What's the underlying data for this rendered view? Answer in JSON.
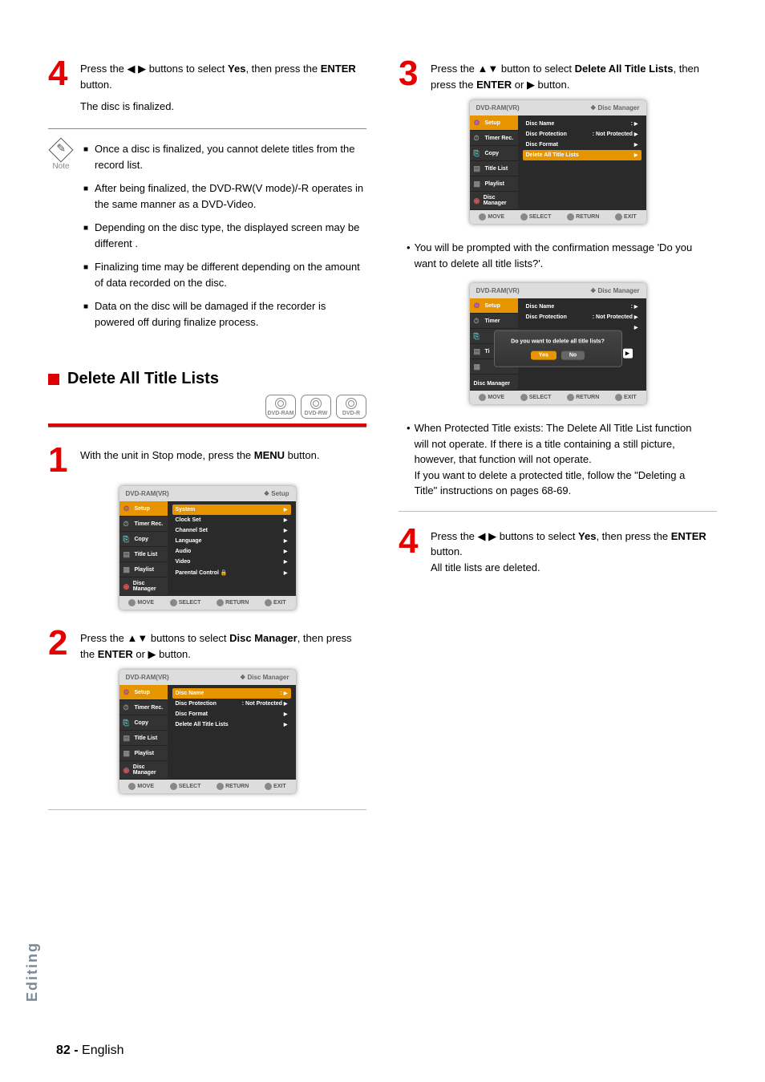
{
  "left": {
    "step4": {
      "text": "Press the ◀ ▶ buttons to select Yes, then press the ENTER button.",
      "sub": "The disc is finalized."
    },
    "note": {
      "label": "Note",
      "items": [
        "Once a disc is finalized, you cannot delete titles from the record list.",
        "After being finalized, the DVD-RW(V mode)/-R operates in the same manner as a DVD-Video.",
        "Depending on the disc type, the displayed screen may be different .",
        "Finalizing time may be different depending on the amount of data recorded on the disc.",
        "Data on the disc will be damaged if the recorder is powered off during finalize process."
      ]
    },
    "section": {
      "title": "Delete All Title Lists"
    },
    "discs": [
      "DVD-RAM",
      "DVD-RW",
      "DVD-R"
    ],
    "step1": {
      "text": "With the unit in Stop mode, press the MENU button."
    },
    "osd1": {
      "headerLeft": "DVD-RAM(VR)",
      "headerRight": "❖  Setup",
      "side": [
        "Setup",
        "Timer Rec.",
        "Copy",
        "Title List",
        "Playlist",
        "Disc Manager"
      ],
      "main": [
        "System",
        "Clock Set",
        "Channel Set",
        "Language",
        "Audio",
        "Video",
        "Parental Control"
      ],
      "foot": [
        "MOVE",
        "SELECT",
        "RETURN",
        "EXIT"
      ]
    },
    "step2": {
      "text": "Press the ▲▼ buttons to select Disc Manager, then press the ENTER or ▶ button."
    },
    "osd2": {
      "headerLeft": "DVD-RAM(VR)",
      "headerRight": "❖ Disc Manager",
      "side": [
        "Setup",
        "Timer Rec.",
        "Copy",
        "Title List",
        "Playlist",
        "Disc Manager"
      ],
      "main": [
        {
          "l": "Disc Name",
          "r": ":"
        },
        {
          "l": "Disc Protection",
          "r": ": Not Protected"
        },
        {
          "l": "Disc Format",
          "r": ""
        },
        {
          "l": "Delete All Title Lists",
          "r": ""
        }
      ],
      "foot": [
        "MOVE",
        "SELECT",
        "RETURN",
        "EXIT"
      ]
    }
  },
  "right": {
    "step3": {
      "text": "Press the ▲▼ button to select Delete All Title Lists, then press the ENTER or ▶ button."
    },
    "osd3": {
      "headerLeft": "DVD-RAM(VR)",
      "headerRight": "❖ Disc Manager",
      "side": [
        "Setup",
        "Timer Rec.",
        "Copy",
        "Title List",
        "Playlist",
        "Disc Manager"
      ],
      "main": [
        {
          "l": "Disc Name",
          "r": ":"
        },
        {
          "l": "Disc Protection",
          "r": ": Not Protected"
        },
        {
          "l": "Disc Format",
          "r": ""
        },
        {
          "l": "Delete All Title Lists",
          "r": ""
        }
      ],
      "foot": [
        "MOVE",
        "SELECT",
        "RETURN",
        "EXIT"
      ]
    },
    "para1": "You will be prompted with the confirmation message 'Do you want to delete all title lists?'.",
    "osd4": {
      "headerLeft": "DVD-RAM(VR)",
      "headerRight": "❖ Disc Manager",
      "side": [
        "Setup",
        "Timer",
        "",
        "Ti",
        "",
        ""
      ],
      "mainTop": [
        {
          "l": "Disc Name",
          "r": ":"
        },
        {
          "l": "Disc Protection",
          "r": ": Not Protected"
        }
      ],
      "dialogMsg": "Do you want to delete all title lists?",
      "dialogYes": "Yes",
      "dialogNo": "No",
      "discManager": "Disc Manager",
      "foot": [
        "MOVE",
        "SELECT",
        "RETURN",
        "EXIT"
      ]
    },
    "para2a": "When Protected Title exists: The Delete All Title List function will not operate. If there is a title containing a still picture, however, that function will not operate.",
    "para2b": "If you want to delete a protected title, follow the \"Deleting a Title\" instructions on pages 68-69.",
    "step4": {
      "text": "Press the ◀ ▶ buttons to select Yes, then press the ENTER button.",
      "sub": "All title lists are deleted."
    }
  },
  "vtab": "Editing",
  "footer": {
    "page": "82 -",
    "lang": "English"
  }
}
